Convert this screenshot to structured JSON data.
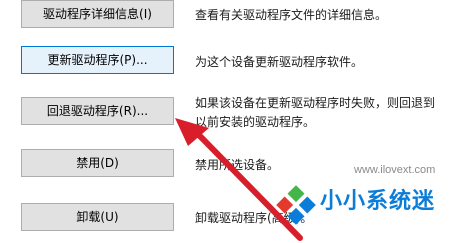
{
  "buttons": [
    {
      "label": "驱动程序详细信息(I)",
      "description": "查看有关驱动程序文件的详细信息。"
    },
    {
      "label": "更新驱动程序(P)...",
      "description": "为这个设备更新驱动程序软件。"
    },
    {
      "label": "回退驱动程序(R)...",
      "description_line1": "如果该设备在更新驱动程序时失败，则回退到",
      "description_line2": "以前安装的驱动程序。"
    },
    {
      "label": "禁用(D)",
      "description": "禁用所选设备。"
    },
    {
      "label": "卸载(U)",
      "description": "卸载驱动程序(高级)。"
    }
  ],
  "watermark": {
    "url": "www.ilovext.com",
    "brand": "小小系统迷"
  },
  "colors": {
    "arrow": "#d81e2a",
    "brand_blue": "#0b7dd8",
    "logo_green": "#43b549",
    "logo_red": "#e33a2f"
  }
}
